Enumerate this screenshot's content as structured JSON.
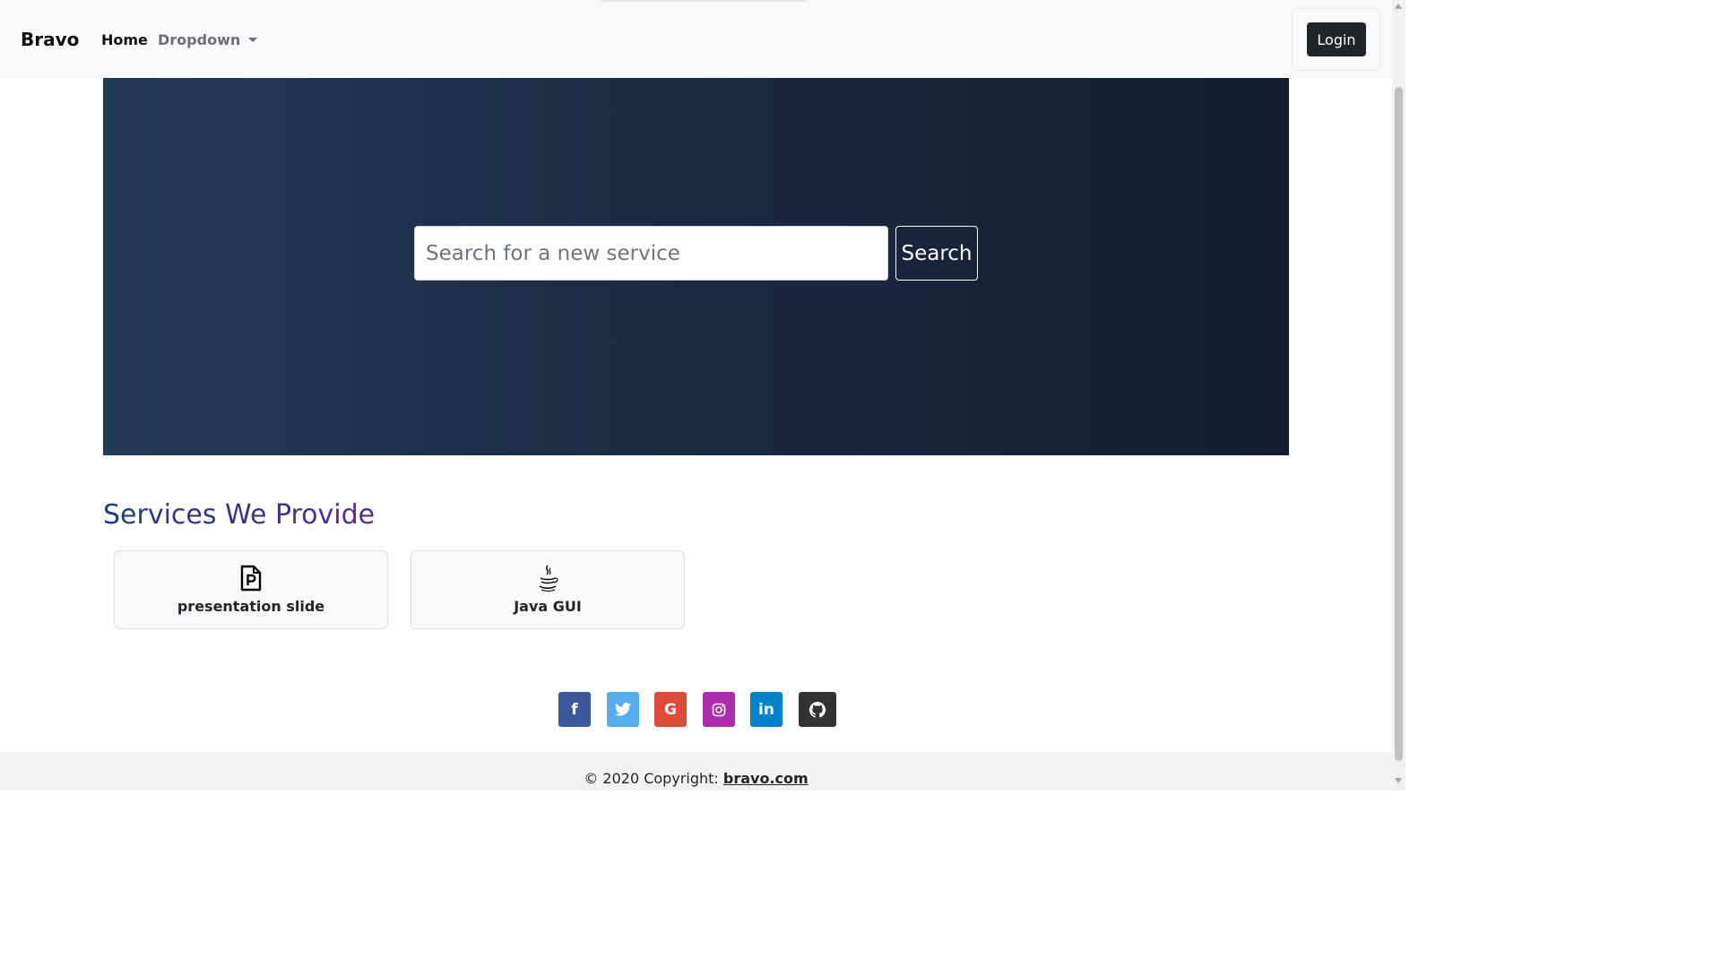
{
  "navbar": {
    "brand": "Bravo",
    "home_label": "Home",
    "dropdown_label": "Dropdown",
    "login_label": "Login"
  },
  "hero": {
    "search_placeholder": "Search for a new service",
    "search_value": "",
    "search_button_label": "Search"
  },
  "services": {
    "title": "Services We Provide",
    "items": [
      {
        "label": "presentation slide",
        "icon": "file-ppt-icon"
      },
      {
        "label": "Java GUI",
        "icon": "java-icon"
      }
    ]
  },
  "social": {
    "items": [
      {
        "name": "facebook",
        "icon": "facebook-icon",
        "color": "#3b5998",
        "glyph": "f"
      },
      {
        "name": "twitter",
        "icon": "twitter-icon",
        "color": "#55acee",
        "glyph": ""
      },
      {
        "name": "google",
        "icon": "google-icon",
        "color": "#dd4b39",
        "glyph": "G"
      },
      {
        "name": "instagram",
        "icon": "instagram-icon",
        "color": "#ac2bac",
        "glyph": ""
      },
      {
        "name": "linkedin",
        "icon": "linkedin-icon",
        "color": "#0082ca",
        "glyph": "in"
      },
      {
        "name": "github",
        "icon": "github-icon",
        "color": "#333333",
        "glyph": ""
      }
    ]
  },
  "footer": {
    "copyright_text": "© 2020 Copyright: ",
    "link_text": "bravo.com"
  },
  "colors": {
    "navbar_bg": "#f8f9fa",
    "hero_gradient_start": "#243b55",
    "hero_gradient_end": "#141e30",
    "login_bg": "#212529"
  }
}
